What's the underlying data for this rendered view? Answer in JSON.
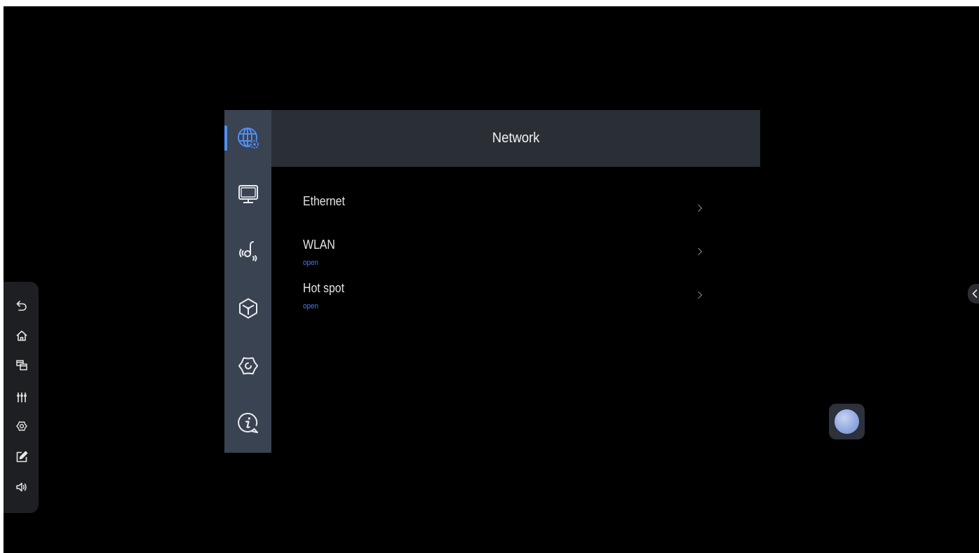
{
  "header": {
    "title": "Network"
  },
  "sidebar": {
    "items": [
      {
        "icon": "network-globe-icon",
        "active": true
      },
      {
        "icon": "display-icon"
      },
      {
        "icon": "audio-icon"
      },
      {
        "icon": "apps-cube-icon"
      },
      {
        "icon": "system-settings-icon"
      },
      {
        "icon": "about-info-icon"
      }
    ]
  },
  "network": {
    "items": [
      {
        "label": "Ethernet"
      },
      {
        "label": "WLAN",
        "status": "open"
      },
      {
        "label": "Hot spot",
        "status": "open"
      }
    ]
  },
  "toolbar": {
    "items": [
      {
        "icon": "back-icon"
      },
      {
        "icon": "home-icon"
      },
      {
        "icon": "windows-icon"
      },
      {
        "icon": "mixer-icon"
      },
      {
        "icon": "settings-icon"
      },
      {
        "icon": "annotate-icon"
      },
      {
        "icon": "volume-icon"
      }
    ]
  },
  "edge_tab": {
    "icon": "chevron-left-icon"
  },
  "float_ball": {
    "icon": "assistive-ball-icon"
  },
  "colors": {
    "accent": "#4f8ef7",
    "status_text": "#3d7cf5",
    "sidebar_bg": "#3a4352",
    "header_bg": "#2a2e35",
    "toolbar_bg": "#1e1f22",
    "background": "#000000"
  }
}
